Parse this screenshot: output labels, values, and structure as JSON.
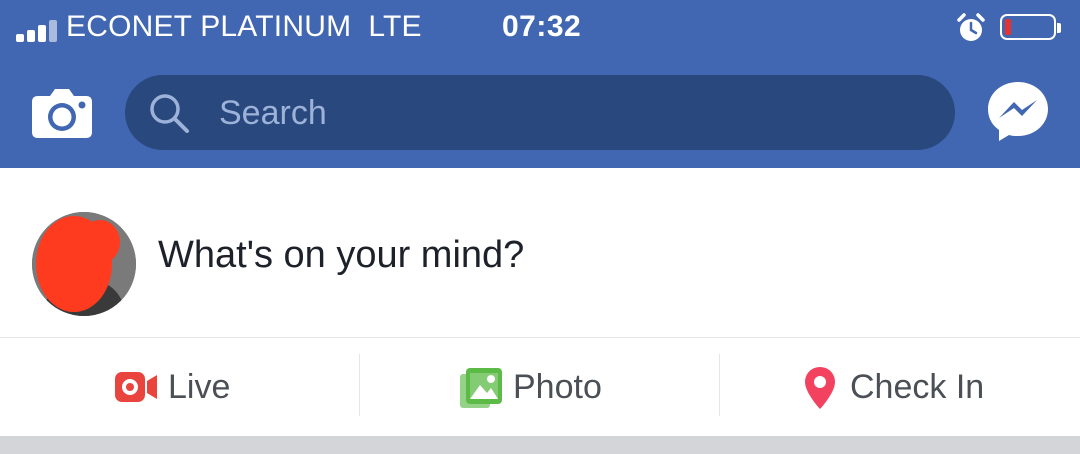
{
  "status_bar": {
    "carrier": "ECONET PLATINUM",
    "network": "LTE",
    "time": "07:32",
    "battery_color": "#e8322e"
  },
  "header": {
    "camera_icon": "camera-icon",
    "search_placeholder": "Search",
    "messenger_icon": "messenger-icon",
    "background_color": "#4267b2"
  },
  "composer": {
    "prompt": "What's on your mind?"
  },
  "actions": [
    {
      "label": "Live",
      "icon": "live-video-icon",
      "color": "#e9443e"
    },
    {
      "label": "Photo",
      "icon": "photo-icon",
      "color": "#5bbb46"
    },
    {
      "label": "Check In",
      "icon": "location-pin-icon",
      "color": "#f3425f"
    }
  ]
}
